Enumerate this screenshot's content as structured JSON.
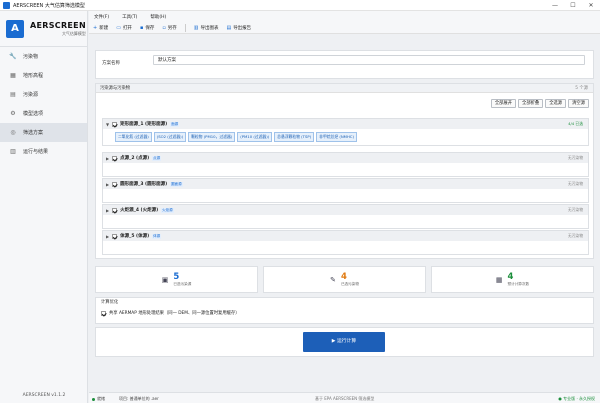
{
  "window": {
    "title": "AERSCREEN 大气估算筛选模型",
    "controls": [
      "—",
      "☐",
      "✕"
    ]
  },
  "brand": {
    "logo": "A",
    "name": "AERSCREEN",
    "subtitle": "大气估算模型"
  },
  "nav": [
    {
      "label": "污染物",
      "icon": "wrench-icon",
      "glyph": "🔧",
      "active": false
    },
    {
      "label": "地形高程",
      "icon": "terrain-icon",
      "glyph": "▦",
      "active": false
    },
    {
      "label": "污染源",
      "icon": "source-icon",
      "glyph": "▤",
      "active": false
    },
    {
      "label": "模型选项",
      "icon": "settings-icon",
      "glyph": "⚙",
      "active": false
    },
    {
      "label": "筛选方案",
      "icon": "scheme-icon",
      "glyph": "◎",
      "active": true
    },
    {
      "label": "运行与结果",
      "icon": "results-icon",
      "glyph": "▥",
      "active": false
    }
  ],
  "version": "AERSCREEN v1.1.2",
  "menu": [
    "文件(F)",
    "工具(T)",
    "帮助(H)"
  ],
  "toolbar": {
    "new": "新建",
    "open": "打开",
    "save": "保存",
    "save_as": "另存",
    "export_chart": "导出图表",
    "export_report": "导出报告"
  },
  "scheme": {
    "label": "方案名称",
    "value": "默认方案"
  },
  "sources_panel": {
    "title": "污染源与污染物",
    "count": "5 个源",
    "buttons": {
      "expand_all": "全部展开",
      "collapse_all": "全部折叠",
      "select_all": "全选源",
      "clear": "清空源"
    },
    "sources": [
      {
        "name": "矩形面源_1 (矩形面源)",
        "tag": "面源",
        "status": "4/4 已选",
        "status_ok": true,
        "expanded": true,
        "pollutants": [
          "二氧化氮 (过滤器)",
          "(SO2 (过滤器))",
          "颗粒物 (PM10，过滤器)",
          "(PM10 (过滤器))",
          "总悬浮颗粒物 (TSP)",
          "非甲烷总烃 (NMHC)"
        ]
      },
      {
        "name": "点源_2 (点源)",
        "tag": "点源",
        "status": "无污染物",
        "status_ok": false,
        "expanded": false,
        "pollutants": []
      },
      {
        "name": "圆形面源_3 (圆形面源)",
        "tag": "圆面源",
        "status": "无污染物",
        "status_ok": false,
        "expanded": false,
        "pollutants": []
      },
      {
        "name": "火炬源_4 (火炬源)",
        "tag": "火炬源",
        "status": "无污染物",
        "status_ok": false,
        "expanded": false,
        "pollutants": []
      },
      {
        "name": "体源_5 (体源)",
        "tag": "体源",
        "status": "无污染物",
        "status_ok": false,
        "expanded": false,
        "pollutants": []
      }
    ]
  },
  "stats": [
    {
      "value": "5",
      "label": "已选污染源",
      "color": "#1a6cd1",
      "icon": "source-count-icon",
      "glyph": "▣"
    },
    {
      "value": "4",
      "label": "已选污染物",
      "color": "#e07a10",
      "icon": "pollutant-count-icon",
      "glyph": "✎"
    },
    {
      "value": "4",
      "label": "预计计算次数",
      "color": "#1b8e3b",
      "icon": "calc-count-icon",
      "glyph": "▦"
    }
  ],
  "options": {
    "title": "计算优化",
    "share_label": "共享 AERMAP 地形处理结果（同一 DEM、同一源位置时复用缓存）",
    "share_checked": true
  },
  "run_button": "▶  运行计算",
  "statusbar": {
    "state": "就绪",
    "project": "项目: 普通单位的 .aer",
    "middle": "基于 EPA AERSCREEN 筛选模型",
    "license": "● 专业版 · 永久授权"
  }
}
